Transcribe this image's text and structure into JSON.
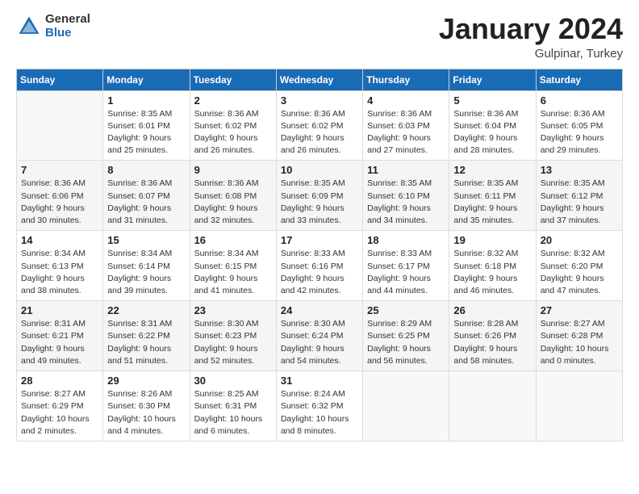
{
  "header": {
    "logo_general": "General",
    "logo_blue": "Blue",
    "title": "January 2024",
    "location": "Gulpinar, Turkey"
  },
  "weekdays": [
    "Sunday",
    "Monday",
    "Tuesday",
    "Wednesday",
    "Thursday",
    "Friday",
    "Saturday"
  ],
  "weeks": [
    [
      {
        "day": "",
        "sunrise": "",
        "sunset": "",
        "daylight": "",
        "empty": true
      },
      {
        "day": "1",
        "sunrise": "Sunrise: 8:35 AM",
        "sunset": "Sunset: 6:01 PM",
        "daylight": "Daylight: 9 hours and 25 minutes."
      },
      {
        "day": "2",
        "sunrise": "Sunrise: 8:36 AM",
        "sunset": "Sunset: 6:02 PM",
        "daylight": "Daylight: 9 hours and 26 minutes."
      },
      {
        "day": "3",
        "sunrise": "Sunrise: 8:36 AM",
        "sunset": "Sunset: 6:02 PM",
        "daylight": "Daylight: 9 hours and 26 minutes."
      },
      {
        "day": "4",
        "sunrise": "Sunrise: 8:36 AM",
        "sunset": "Sunset: 6:03 PM",
        "daylight": "Daylight: 9 hours and 27 minutes."
      },
      {
        "day": "5",
        "sunrise": "Sunrise: 8:36 AM",
        "sunset": "Sunset: 6:04 PM",
        "daylight": "Daylight: 9 hours and 28 minutes."
      },
      {
        "day": "6",
        "sunrise": "Sunrise: 8:36 AM",
        "sunset": "Sunset: 6:05 PM",
        "daylight": "Daylight: 9 hours and 29 minutes."
      }
    ],
    [
      {
        "day": "7",
        "sunrise": "",
        "sunset": "",
        "daylight": ""
      },
      {
        "day": "8",
        "sunrise": "Sunrise: 8:36 AM",
        "sunset": "Sunset: 6:07 PM",
        "daylight": "Daylight: 9 hours and 31 minutes."
      },
      {
        "day": "9",
        "sunrise": "Sunrise: 8:36 AM",
        "sunset": "Sunset: 6:08 PM",
        "daylight": "Daylight: 9 hours and 32 minutes."
      },
      {
        "day": "10",
        "sunrise": "Sunrise: 8:35 AM",
        "sunset": "Sunset: 6:09 PM",
        "daylight": "Daylight: 9 hours and 33 minutes."
      },
      {
        "day": "11",
        "sunrise": "Sunrise: 8:35 AM",
        "sunset": "Sunset: 6:10 PM",
        "daylight": "Daylight: 9 hours and 34 minutes."
      },
      {
        "day": "12",
        "sunrise": "Sunrise: 8:35 AM",
        "sunset": "Sunset: 6:11 PM",
        "daylight": "Daylight: 9 hours and 35 minutes."
      },
      {
        "day": "13",
        "sunrise": "Sunrise: 8:35 AM",
        "sunset": "Sunset: 6:12 PM",
        "daylight": "Daylight: 9 hours and 37 minutes."
      }
    ],
    [
      {
        "day": "14",
        "sunrise": "",
        "sunset": "",
        "daylight": ""
      },
      {
        "day": "15",
        "sunrise": "Sunrise: 8:34 AM",
        "sunset": "Sunset: 6:14 PM",
        "daylight": "Daylight: 9 hours and 39 minutes."
      },
      {
        "day": "16",
        "sunrise": "Sunrise: 8:34 AM",
        "sunset": "Sunset: 6:15 PM",
        "daylight": "Daylight: 9 hours and 41 minutes."
      },
      {
        "day": "17",
        "sunrise": "Sunrise: 8:33 AM",
        "sunset": "Sunset: 6:16 PM",
        "daylight": "Daylight: 9 hours and 42 minutes."
      },
      {
        "day": "18",
        "sunrise": "Sunrise: 8:33 AM",
        "sunset": "Sunset: 6:17 PM",
        "daylight": "Daylight: 9 hours and 44 minutes."
      },
      {
        "day": "19",
        "sunrise": "Sunrise: 8:32 AM",
        "sunset": "Sunset: 6:18 PM",
        "daylight": "Daylight: 9 hours and 46 minutes."
      },
      {
        "day": "20",
        "sunrise": "Sunrise: 8:32 AM",
        "sunset": "Sunset: 6:20 PM",
        "daylight": "Daylight: 9 hours and 47 minutes."
      }
    ],
    [
      {
        "day": "21",
        "sunrise": "",
        "sunset": "",
        "daylight": ""
      },
      {
        "day": "22",
        "sunrise": "Sunrise: 8:31 AM",
        "sunset": "Sunset: 6:22 PM",
        "daylight": "Daylight: 9 hours and 51 minutes."
      },
      {
        "day": "23",
        "sunrise": "Sunrise: 8:30 AM",
        "sunset": "Sunset: 6:23 PM",
        "daylight": "Daylight: 9 hours and 52 minutes."
      },
      {
        "day": "24",
        "sunrise": "Sunrise: 8:30 AM",
        "sunset": "Sunset: 6:24 PM",
        "daylight": "Daylight: 9 hours and 54 minutes."
      },
      {
        "day": "25",
        "sunrise": "Sunrise: 8:29 AM",
        "sunset": "Sunset: 6:25 PM",
        "daylight": "Daylight: 9 hours and 56 minutes."
      },
      {
        "day": "26",
        "sunrise": "Sunrise: 8:28 AM",
        "sunset": "Sunset: 6:26 PM",
        "daylight": "Daylight: 9 hours and 58 minutes."
      },
      {
        "day": "27",
        "sunrise": "Sunrise: 8:27 AM",
        "sunset": "Sunset: 6:28 PM",
        "daylight": "Daylight: 10 hours and 0 minutes."
      }
    ],
    [
      {
        "day": "28",
        "sunrise": "",
        "sunset": "",
        "daylight": ""
      },
      {
        "day": "29",
        "sunrise": "Sunrise: 8:26 AM",
        "sunset": "Sunset: 6:30 PM",
        "daylight": "Daylight: 10 hours and 4 minutes."
      },
      {
        "day": "30",
        "sunrise": "Sunrise: 8:25 AM",
        "sunset": "Sunset: 6:31 PM",
        "daylight": "Daylight: 10 hours and 6 minutes."
      },
      {
        "day": "31",
        "sunrise": "Sunrise: 8:24 AM",
        "sunset": "Sunset: 6:32 PM",
        "daylight": "Daylight: 10 hours and 8 minutes."
      },
      {
        "day": "",
        "sunrise": "",
        "sunset": "",
        "daylight": "",
        "empty": true
      },
      {
        "day": "",
        "sunrise": "",
        "sunset": "",
        "daylight": "",
        "empty": true
      },
      {
        "day": "",
        "sunrise": "",
        "sunset": "",
        "daylight": "",
        "empty": true
      }
    ]
  ],
  "week0_sunday": {
    "sunrise": "Sunrise: 8:36 AM",
    "sunset": "Sunset: 6:06 PM",
    "daylight": "Daylight: 9 hours and 30 minutes."
  },
  "week1_sunday": {
    "sunrise": "Sunrise: 8:36 AM",
    "sunset": "Sunset: 6:06 PM",
    "daylight": "Daylight: 9 hours and 30 minutes."
  },
  "week2_sunday": {
    "sunrise": "Sunrise: 8:34 AM",
    "sunset": "Sunset: 6:13 PM",
    "daylight": "Daylight: 9 hours and 38 minutes."
  },
  "week3_sunday": {
    "sunrise": "Sunrise: 8:31 AM",
    "sunset": "Sunset: 6:21 PM",
    "daylight": "Daylight: 9 hours and 49 minutes."
  },
  "week4_sunday": {
    "sunrise": "Sunrise: 8:27 AM",
    "sunset": "Sunset: 6:29 PM",
    "daylight": "Daylight: 10 hours and 2 minutes."
  }
}
